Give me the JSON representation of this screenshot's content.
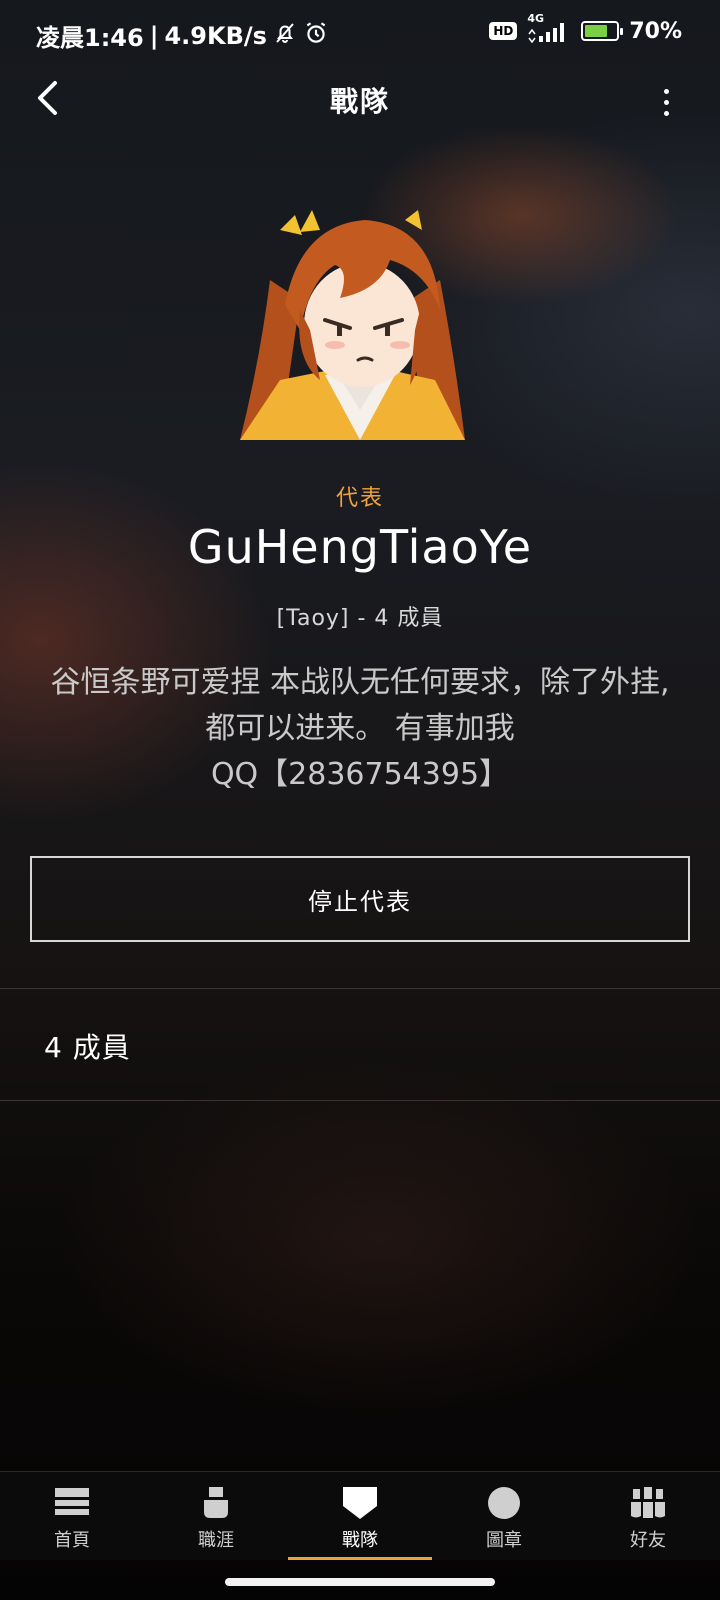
{
  "status_bar": {
    "time": "凌晨1:46",
    "net_speed": "4.9KB/s",
    "network": "4G",
    "hd": "HD",
    "battery": "70%"
  },
  "header": {
    "title": "戰隊"
  },
  "clan": {
    "role": "代表",
    "name": "GuHengTiaoYe",
    "meta": "[Taoy] - 4 成員",
    "description": "谷恒条野可爱捏 本战队无任何要求，除了外挂,都可以进来。 有事加我\nQQ【2836754395】",
    "stop_button": "停止代表",
    "members_label": "4 成員"
  },
  "bottom_nav": {
    "items": [
      {
        "label": "首頁",
        "icon": "home-icon",
        "active": false
      },
      {
        "label": "職涯",
        "icon": "career-icon",
        "active": false
      },
      {
        "label": "戰隊",
        "icon": "clan-icon",
        "active": true
      },
      {
        "label": "圖章",
        "icon": "emblem-icon",
        "active": false
      },
      {
        "label": "好友",
        "icon": "friends-icon",
        "active": false
      }
    ]
  },
  "colors": {
    "accent": "#f0a23a"
  }
}
